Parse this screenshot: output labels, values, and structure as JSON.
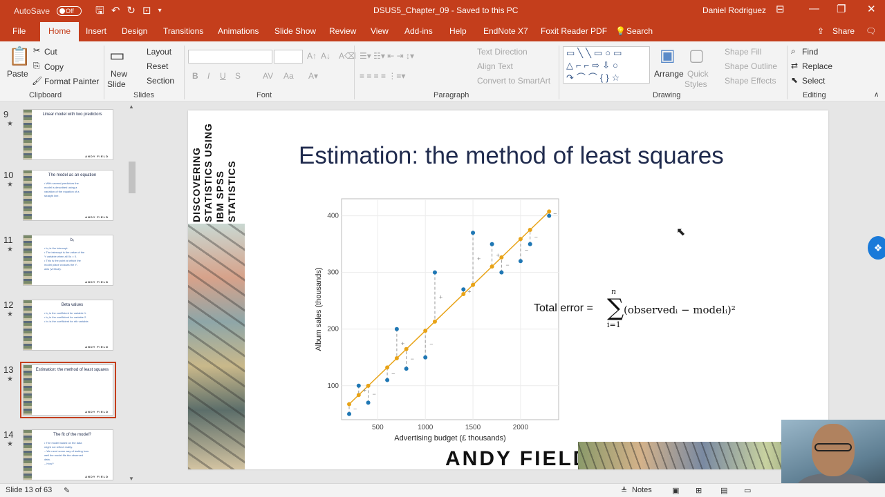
{
  "titlebar": {
    "autosave_label": "AutoSave",
    "autosave_state": "Off",
    "document_title": "DSUS5_Chapter_09  -  Saved to this PC",
    "user_name": "Daniel Rodriguez"
  },
  "tabs": [
    "File",
    "Home",
    "Insert",
    "Design",
    "Transitions",
    "Animations",
    "Slide Show",
    "Review",
    "View",
    "Add-ins",
    "Help",
    "EndNote X7",
    "Foxit Reader PDF"
  ],
  "search_label": "Search",
  "share_label": "Share",
  "ribbon": {
    "clipboard": {
      "paste": "Paste",
      "cut": "Cut",
      "copy": "Copy",
      "format_painter": "Format Painter",
      "group": "Clipboard"
    },
    "slides": {
      "new_slide_1": "New",
      "new_slide_2": "Slide",
      "layout": "Layout",
      "reset": "Reset",
      "section": "Section",
      "group": "Slides"
    },
    "font": {
      "group": "Font",
      "bold": "B",
      "italic": "I",
      "underline": "U",
      "strike": "S",
      "aa": "Aa",
      "spacing": "AV"
    },
    "paragraph": {
      "text_direction": "Text Direction",
      "align_text": "Align Text",
      "convert_smartart": "Convert to SmartArt",
      "group": "Paragraph"
    },
    "drawing": {
      "arrange": "Arrange",
      "quick_styles_1": "Quick",
      "quick_styles_2": "Styles",
      "shape_fill": "Shape Fill",
      "shape_outline": "Shape Outline",
      "shape_effects": "Shape Effects",
      "group": "Drawing"
    },
    "editing": {
      "find": "Find",
      "replace": "Replace",
      "select": "Select",
      "group": "Editing"
    }
  },
  "thumbnails": [
    {
      "num": "9",
      "title": "Linear model with two predictors",
      "lines": []
    },
    {
      "num": "10",
      "title": "The model as an equation",
      "lines": [
        "• With several predictors the",
        "model is described using a",
        "variation of the equation of a",
        "straight line."
      ]
    },
    {
      "num": "11",
      "title": "b₀",
      "lines": [
        "• b₀ is the intercept.",
        "• The intercept is the value of the",
        "Y variable when all Xs = 0.",
        "• This is the point at which the",
        "model plane crosses the Y-",
        "axis (vertical)."
      ]
    },
    {
      "num": "12",
      "title": "Beta values",
      "lines": [
        "• b₁ is the coefficient for variable 1.",
        "• b₂ is the coefficient for variable 2.",
        "• bₙ is the coefficient for nth variable."
      ]
    },
    {
      "num": "13",
      "title": "Estimation: the method of least squares",
      "lines": []
    },
    {
      "num": "14",
      "title": "The fit of the model?",
      "lines": [
        "• The model based on the data",
        "might not reflect reality.",
        "– We need some way of testing how",
        "well the model fits the observed",
        "data.",
        "– How?"
      ]
    }
  ],
  "thumb_footer": "ANDY FIELD",
  "slide": {
    "book_title": "DISCOVERING STATISTICS USING IBM SPSS STATISTICS",
    "title": "Estimation: the method of least squares",
    "formula_lhs": "Total error =",
    "formula_sum_top": "n",
    "formula_sum_bottom": "i=1",
    "formula_rhs": "(observedᵢ − modelᵢ)²",
    "author": "ANDY FIELD"
  },
  "chart_data": {
    "type": "scatter",
    "xlabel": "Advertising budget (£ thousands)",
    "ylabel": "Album sales (thousands)",
    "xlim": [
      120,
      2400
    ],
    "ylim": [
      40,
      430
    ],
    "xticks": [
      500,
      1000,
      1500,
      2000
    ],
    "yticks": [
      100,
      200,
      300,
      400
    ],
    "grid": true,
    "observed": [
      {
        "x": 200,
        "y": 50
      },
      {
        "x": 300,
        "y": 100
      },
      {
        "x": 400,
        "y": 70
      },
      {
        "x": 600,
        "y": 110
      },
      {
        "x": 700,
        "y": 200
      },
      {
        "x": 800,
        "y": 130
      },
      {
        "x": 1000,
        "y": 150
      },
      {
        "x": 1100,
        "y": 300
      },
      {
        "x": 1400,
        "y": 270
      },
      {
        "x": 1500,
        "y": 370
      },
      {
        "x": 1700,
        "y": 350
      },
      {
        "x": 1800,
        "y": 300
      },
      {
        "x": 2000,
        "y": 320
      },
      {
        "x": 2100,
        "y": 350
      },
      {
        "x": 2300,
        "y": 400
      }
    ],
    "model_line": {
      "intercept": 35,
      "slope": 0.162
    },
    "colors": {
      "observed": "#1f77b4",
      "model": "#e8a317"
    }
  },
  "statusbar": {
    "slide_info": "Slide 13 of 63",
    "notes": "Notes"
  },
  "colors": {
    "accent": "#c43e1c",
    "slide_title": "#1f2a4d"
  }
}
